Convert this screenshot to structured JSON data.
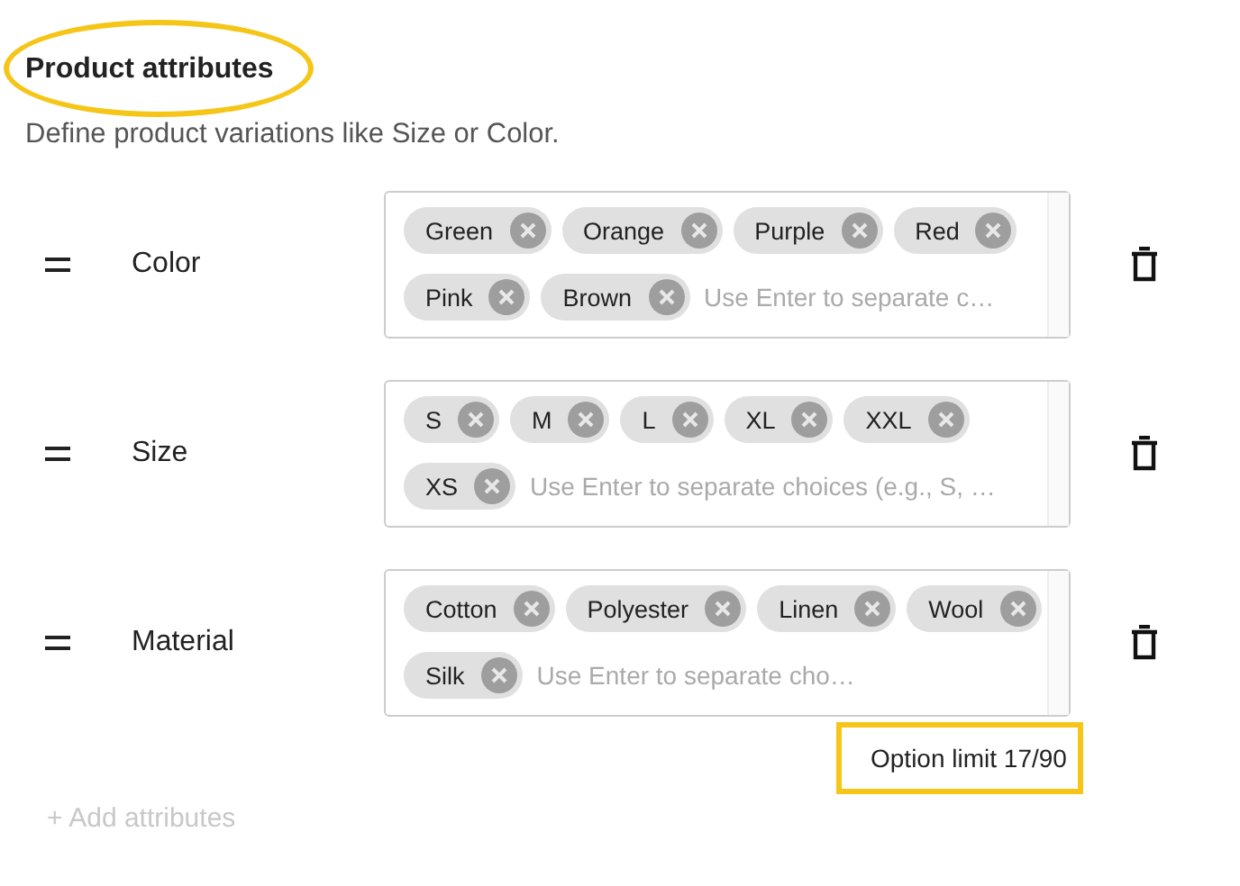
{
  "title": {
    "text": "Product attributes",
    "highlighted": true
  },
  "subtitle": "Define product variations like Size or Color.",
  "attributes": [
    {
      "name": "Color",
      "choices": [
        "Green",
        "Orange",
        "Purple",
        "Red",
        "Pink",
        "Brown"
      ],
      "placeholder": "Use Enter to separate c…"
    },
    {
      "name": "Size",
      "choices": [
        "S",
        "M",
        "L",
        "XL",
        "XXL",
        "XS"
      ],
      "placeholder": "Use Enter to separate choices (e.g., S, …"
    },
    {
      "name": "Material",
      "choices": [
        "Cotton",
        "Polyester",
        "Linen",
        "Wool",
        "Silk"
      ],
      "placeholder": "Use Enter to separate cho…"
    }
  ],
  "option_limit": {
    "text": "Option limit 17/90",
    "highlighted": true
  },
  "add_button": {
    "label": "+ Add attributes",
    "disabled": true
  }
}
